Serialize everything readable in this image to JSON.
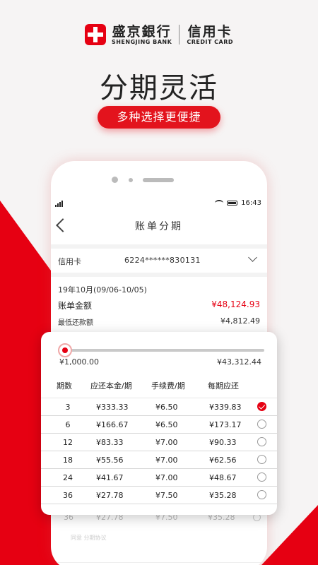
{
  "brand": {
    "name_cn": "盛京銀行",
    "name_en": "SHENGJING BANK",
    "product_cn": "信用卡",
    "product_en": "CREDIT CARD"
  },
  "headline": "分期灵活",
  "tagline": "多种选择更便捷",
  "colors": {
    "accent": "#e60012",
    "text": "#222222"
  },
  "status_bar": {
    "time": "16:43"
  },
  "nav": {
    "title": "账单分期"
  },
  "card": {
    "label": "信用卡",
    "number": "6224******830131"
  },
  "bill": {
    "period": "19年10月(09/06-10/05)",
    "amount_label": "账单金额",
    "amount": "¥48,124.93",
    "min_label": "最低还款额",
    "min_amount": "¥4,812.49"
  },
  "slider": {
    "min_label": "¥1,000.00",
    "max_label": "¥43,312.44",
    "position": 0.0
  },
  "table": {
    "headers": [
      "期数",
      "应还本金/期",
      "手续费/期",
      "每期应还"
    ],
    "rows": [
      {
        "periods": "3",
        "principal": "¥333.33",
        "fee": "¥6.50",
        "total": "¥339.83",
        "selected": true
      },
      {
        "periods": "6",
        "principal": "¥166.67",
        "fee": "¥6.50",
        "total": "¥173.17",
        "selected": false
      },
      {
        "periods": "12",
        "principal": "¥83.33",
        "fee": "¥7.00",
        "total": "¥90.33",
        "selected": false
      },
      {
        "periods": "18",
        "principal": "¥55.56",
        "fee": "¥7.00",
        "total": "¥62.56",
        "selected": false
      },
      {
        "periods": "24",
        "principal": "¥41.67",
        "fee": "¥7.00",
        "total": "¥48.67",
        "selected": false
      },
      {
        "periods": "36",
        "principal": "¥27.78",
        "fee": "¥7.50",
        "total": "¥35.28",
        "selected": false
      }
    ]
  },
  "ghost": {
    "periods": "36",
    "principal": "¥27.78",
    "fee": "¥7.50",
    "total": "¥35.28",
    "agreement": "同意 分期协议"
  }
}
